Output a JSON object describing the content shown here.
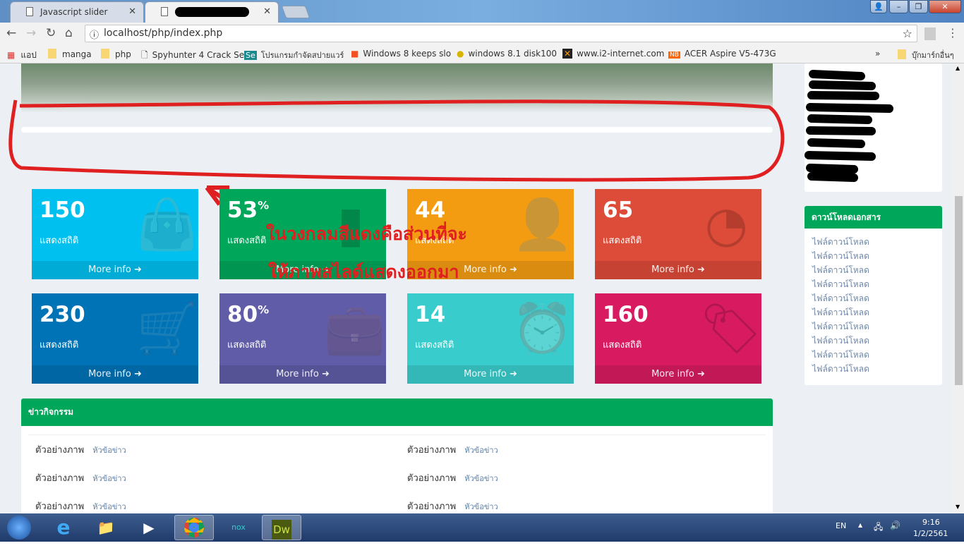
{
  "browser": {
    "tabs": [
      {
        "label": "Javascript slider"
      },
      {
        "label": ""
      }
    ],
    "url": "localhost/php/index.php",
    "bookmarks": [
      "แอป",
      "manga",
      "php",
      "Spyhunter 4 Crack Se",
      "โปรแกรมกำจัดสปายแวร์",
      "Windows 8 keeps slo",
      "windows 8.1 disk100",
      "www.i2-internet.com",
      "ACER Aspire V5-473G"
    ],
    "more": "»",
    "other_bookmarks": "บุ๊กมาร์กอื่นๆ"
  },
  "boxes": [
    {
      "value": "150",
      "suffix": "",
      "label": "แสดงสถิติ",
      "more": "More info",
      "color": "#00c0ef",
      "icon": "shopping-bag-icon"
    },
    {
      "value": "53",
      "suffix": "%",
      "label": "แสดงสถิติ",
      "more": "More info",
      "color": "#00a65a",
      "icon": "bar-chart-icon"
    },
    {
      "value": "44",
      "suffix": "",
      "label": "แสดงสถิติ",
      "more": "More info",
      "color": "#f39c12",
      "icon": "user-plus-icon"
    },
    {
      "value": "65",
      "suffix": "",
      "label": "แสดงสถิติ",
      "more": "More info",
      "color": "#dd4b39",
      "icon": "pie-chart-icon"
    },
    {
      "value": "230",
      "suffix": "",
      "label": "แสดงสถิติ",
      "more": "More info",
      "color": "#0073b7",
      "icon": "shopping-cart-icon"
    },
    {
      "value": "80",
      "suffix": "%",
      "label": "แสดงสถิติ",
      "more": "More info",
      "color": "#605ca8",
      "icon": "briefcase-icon"
    },
    {
      "value": "14",
      "suffix": "",
      "label": "แสดงสถิติ",
      "more": "More info",
      "color": "#39cccc",
      "icon": "alarm-clock-icon"
    },
    {
      "value": "160",
      "suffix": "",
      "label": "แสดงสถิติ",
      "more": "More info",
      "color": "#d81b60",
      "icon": "tag-icon"
    }
  ],
  "annotation": {
    "line1": "ในวงกลมสีแดงคือส่วนที่จะ",
    "line2": "ให้ภาพสไลด์แสดงออกมา"
  },
  "downloads": {
    "title": "ดาวน์โหลดเอกสาร",
    "items": [
      "ไฟล์ดาวน์โหลด",
      "ไฟล์ดาวน์โหลด",
      "ไฟล์ดาวน์โหลด",
      "ไฟล์ดาวน์โหลด",
      "ไฟล์ดาวน์โหลด",
      "ไฟล์ดาวน์โหลด",
      "ไฟล์ดาวน์โหลด",
      "ไฟล์ดาวน์โหลด",
      "ไฟล์ดาวน์โหลด",
      "ไฟล์ดาวน์โหลด"
    ]
  },
  "news": {
    "title": "ข่าวกิจกรรม",
    "rows": [
      {
        "image": "ตัวอย่างภาพ",
        "headline": "หัวข้อข่าว"
      },
      {
        "image": "ตัวอย่างภาพ",
        "headline": "หัวข้อข่าว"
      },
      {
        "image": "ตัวอย่างภาพ",
        "headline": "หัวข้อข่าว"
      },
      {
        "image": "ตัวอย่างภาพ",
        "headline": "หัวข้อข่าว"
      },
      {
        "image": "ตัวอย่างภาพ",
        "headline": "หัวข้อข่าว"
      },
      {
        "image": "ตัวอย่างภาพ",
        "headline": "หัวข้อข่าว"
      }
    ]
  },
  "taskbar": {
    "apps": [
      "start",
      "internet-explorer",
      "explorer",
      "media-player",
      "chrome",
      "nox",
      "dreamweaver"
    ],
    "dw_label": "Dw",
    "lang": "EN",
    "time": "9:16",
    "date": "1/2/2561"
  }
}
